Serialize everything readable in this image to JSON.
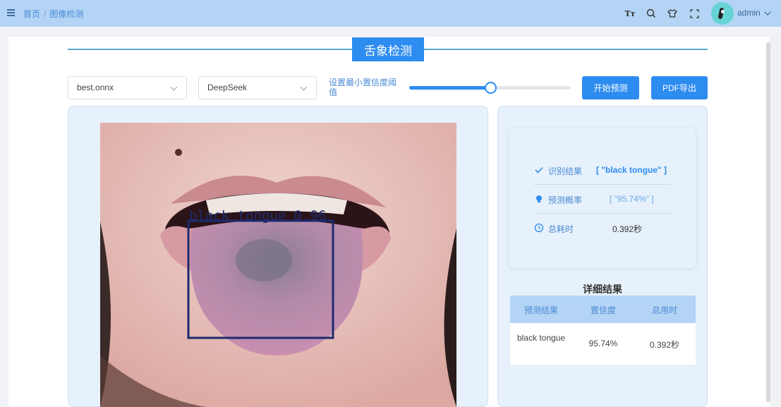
{
  "breadcrumb": {
    "home": "首页",
    "separator": "/",
    "current": "图像检测"
  },
  "header": {
    "tools": [
      "font-size-icon",
      "search-icon",
      "theme-icon",
      "fullscreen-icon"
    ],
    "font_tool_glyph": "Tт",
    "user": "admin"
  },
  "page": {
    "title": "舌象检测"
  },
  "controls": {
    "model_select": "best.onnx",
    "llm_select": "DeepSeek",
    "threshold_label": "设置最小置信度阈值",
    "threshold_value": 0.5,
    "predict_button": "开始预测",
    "export_button": "PDF导出"
  },
  "detection": {
    "label": "black tongue 0.96"
  },
  "result": {
    "class_label": "识别结果",
    "class_value": "[ \"black tongue\" ]",
    "prob_label": "预测概率",
    "prob_value": "[ \"95.74%\" ]",
    "time_label": "总耗时",
    "time_value": "0.392秒"
  },
  "detail": {
    "title": "详细结果",
    "columns": [
      "预测结果",
      "置信度",
      "总用时"
    ],
    "row": {
      "class": "black tongue",
      "confidence": "95.74%",
      "time": "0.392秒"
    }
  },
  "colors": {
    "accent": "#2d8cf0",
    "header_bg": "#b3d4f5",
    "panel_bg": "#e6f1fb",
    "box": "#1e2a6e"
  }
}
